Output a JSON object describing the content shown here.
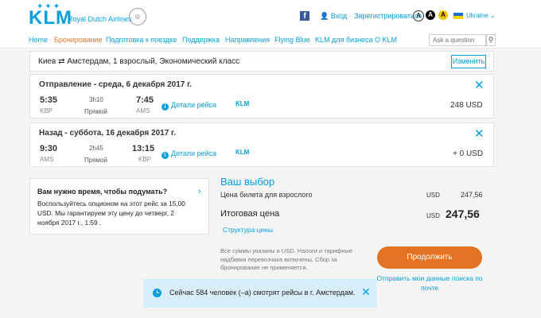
{
  "header": {
    "logo": "KLM",
    "tagline": "Royal Dutch Airlines",
    "facebook_icon": "f",
    "login": "Вход",
    "register": "Зарегистрироваться",
    "accessibility": [
      "A",
      "A",
      "A"
    ],
    "language": "Ukraine"
  },
  "nav": {
    "items": [
      {
        "label": "Home"
      },
      {
        "label": "Бронирование"
      },
      {
        "label": "Подготовка к поездке"
      },
      {
        "label": "Поддержка"
      },
      {
        "label": "Направления"
      },
      {
        "label": "Flying Blue"
      },
      {
        "label": "KLM для бизнеса"
      },
      {
        "label": "О KLM"
      }
    ],
    "active_item": "Бронирование",
    "search_placeholder": "Ask a question"
  },
  "trip": {
    "summary": "Киев ⇄ Амстердам, 1 взрослый, Экономический класс",
    "change_label": "Изменить"
  },
  "legs": [
    {
      "title": "Отправление - среда, 6 декабря 2017 г.",
      "dep_time": "5:35",
      "dep_code": "KBP",
      "duration": "3h10",
      "type": "Прямой",
      "arr_time": "7:45",
      "arr_code": "AMS",
      "details_label": "Детали рейса",
      "carrier": "KLM",
      "price": "248 USD"
    },
    {
      "title": "Назад - суббота, 16 декабря 2017 г.",
      "dep_time": "9:30",
      "dep_code": "AMS",
      "duration": "2h45",
      "type": "Прямой",
      "arr_time": "13:15",
      "arr_code": "KBP",
      "details_label": "Детали рейса",
      "carrier": "KLM",
      "price": "+ 0 USD"
    }
  ],
  "think": {
    "title": "Вам нужно время, чтобы подумать?",
    "text": "Воспользуйтесь опционом на этот рейс за 15,00 USD. Мы гарантируем эту цену до четверг, 2 ноября 2017 г., 1:59 ."
  },
  "choice": {
    "title": "Ваш выбор",
    "adult_label": "Цена билета для взрослого",
    "adult_currency": "USD",
    "adult_value": "247,56",
    "total_label": "Итоговая цена",
    "total_currency": "USD",
    "total_value": "247,56",
    "structure_link": "Структура цены",
    "disclaimer": "Все суммы указаны в USD. Налоги и тарифные надбавки перевозчика включены. Сбор за бронирование не применяется.",
    "continue_label": "Продолжить",
    "save_link": "Отправить мои данные поиска по почте"
  },
  "toast": {
    "text": "Сейчас 584 человек (–а) смотрят рейсы в г. Амстердам."
  },
  "colors": {
    "brand": "#00a1de",
    "accent": "#e37222",
    "toast_bg": "#d9eefb"
  }
}
